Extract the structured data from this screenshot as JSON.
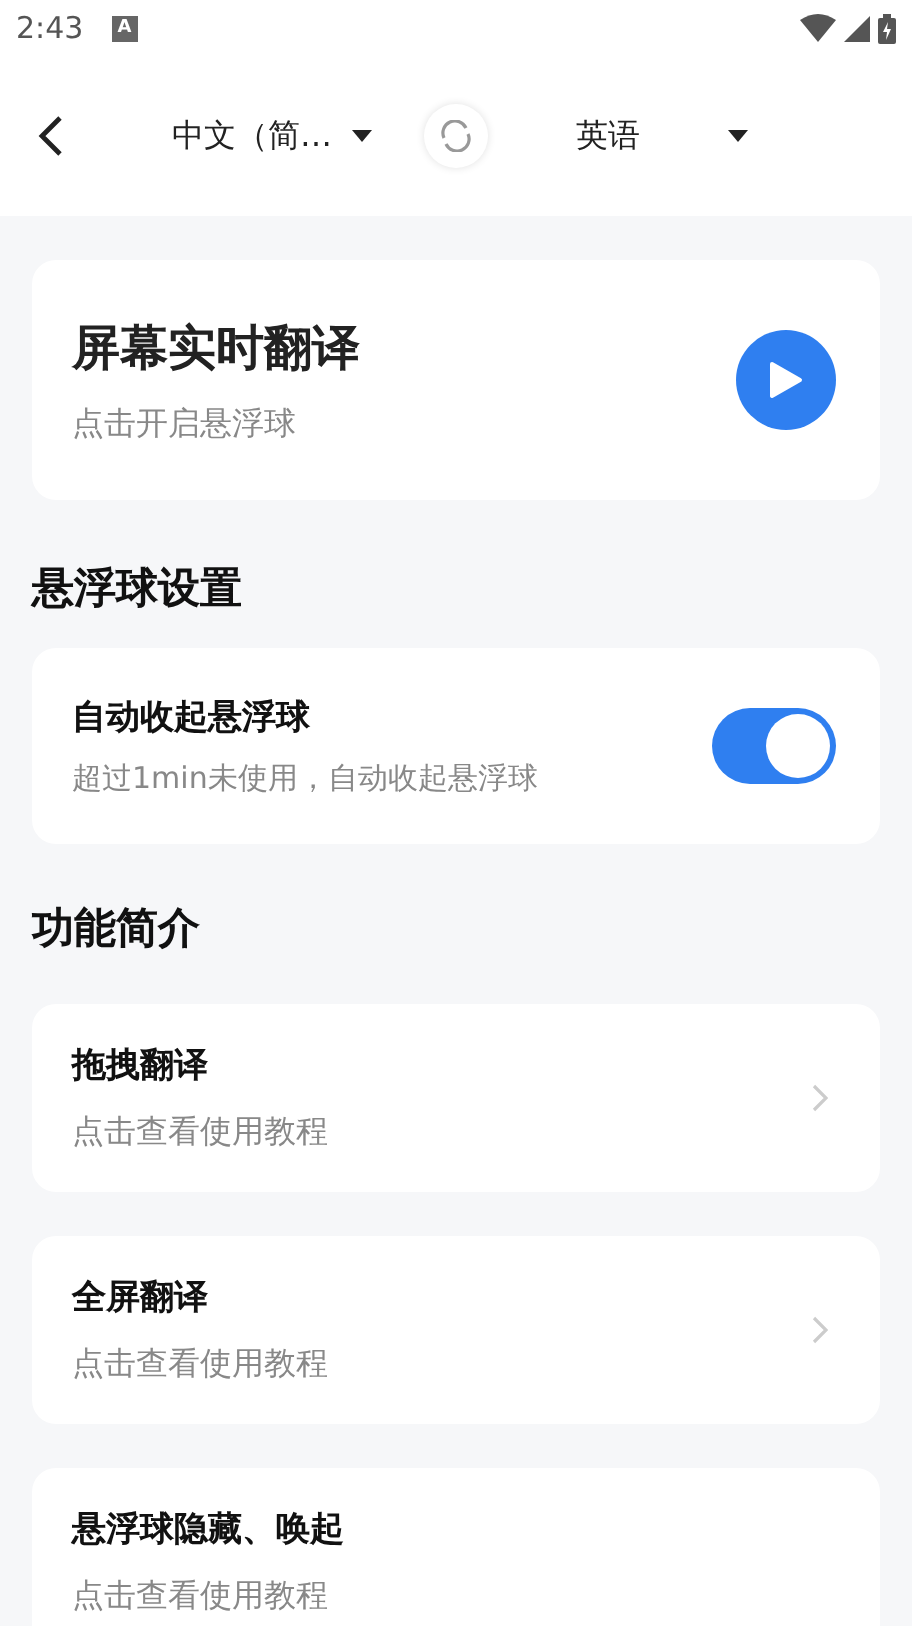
{
  "status_bar": {
    "time": "2:43",
    "notification_icon": "A"
  },
  "header": {
    "source_language": "中文（简…",
    "target_language": "英语"
  },
  "live_translate": {
    "title": "屏幕实时翻译",
    "subtitle": "点击开启悬浮球"
  },
  "float_settings": {
    "heading": "悬浮球设置",
    "items": [
      {
        "title": "自动收起悬浮球",
        "subtitle": "超过1min未使用，自动收起悬浮球",
        "on": true
      }
    ]
  },
  "features": {
    "heading": "功能简介",
    "items": [
      {
        "title": "拖拽翻译",
        "subtitle": "点击查看使用教程",
        "arrow": true
      },
      {
        "title": "全屏翻译",
        "subtitle": "点击查看使用教程",
        "arrow": true
      },
      {
        "title": "悬浮球隐藏、唤起",
        "subtitle": "点击查看使用教程",
        "arrow": false
      }
    ]
  }
}
